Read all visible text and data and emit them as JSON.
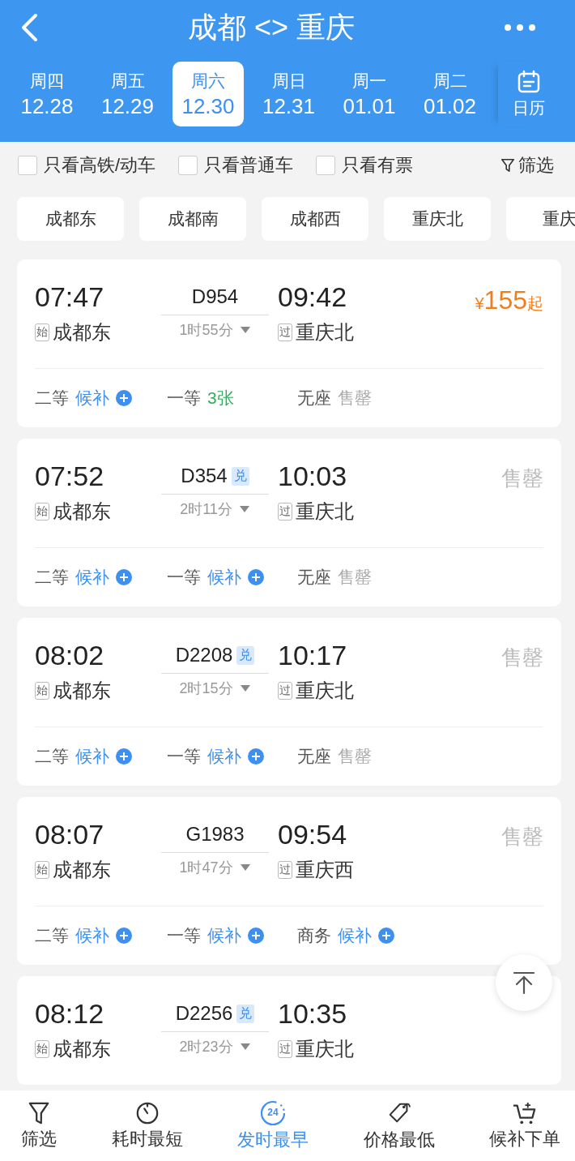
{
  "header": {
    "title": "成都 <> 重庆"
  },
  "dates": [
    {
      "weekday": "周四",
      "date": "12.28",
      "selected": false
    },
    {
      "weekday": "周五",
      "date": "12.29",
      "selected": false
    },
    {
      "weekday": "周六",
      "date": "12.30",
      "selected": true
    },
    {
      "weekday": "周日",
      "date": "12.31",
      "selected": false
    },
    {
      "weekday": "周一",
      "date": "01.01",
      "selected": false
    },
    {
      "weekday": "周二",
      "date": "01.02",
      "selected": false
    }
  ],
  "calendar_label": "日历",
  "filters": [
    {
      "label": "只看高铁/动车",
      "checked": false
    },
    {
      "label": "只看普通车",
      "checked": false
    },
    {
      "label": "只看有票",
      "checked": false
    }
  ],
  "filter_button": "筛选",
  "stations": [
    "成都东",
    "成都南",
    "成都西",
    "重庆北",
    "重庆"
  ],
  "trains": [
    {
      "depart": "07:47",
      "number": "D954",
      "arrive": "09:42",
      "from_tag": "始",
      "from": "成都东",
      "duration": "1时55分",
      "to_tag": "过",
      "to": "重庆北",
      "fare": {
        "kind": "price",
        "currency": "¥",
        "amount": "155",
        "suffix": "起"
      },
      "seats": [
        {
          "class": "二等",
          "status": "候补",
          "kind": "waitlist"
        },
        {
          "class": "一等",
          "status": "3张",
          "kind": "count"
        },
        {
          "class": "无座",
          "status": "售罄",
          "kind": "soldout"
        }
      ]
    },
    {
      "depart": "07:52",
      "number": "D354",
      "badge": "兑",
      "arrive": "10:03",
      "from_tag": "始",
      "from": "成都东",
      "duration": "2时11分",
      "to_tag": "过",
      "to": "重庆北",
      "fare": {
        "kind": "soldout",
        "text": "售罄"
      },
      "seats": [
        {
          "class": "二等",
          "status": "候补",
          "kind": "waitlist"
        },
        {
          "class": "一等",
          "status": "候补",
          "kind": "waitlist"
        },
        {
          "class": "无座",
          "status": "售罄",
          "kind": "soldout"
        }
      ]
    },
    {
      "depart": "08:02",
      "number": "D2208",
      "badge": "兑",
      "arrive": "10:17",
      "from_tag": "始",
      "from": "成都东",
      "duration": "2时15分",
      "to_tag": "过",
      "to": "重庆北",
      "fare": {
        "kind": "soldout",
        "text": "售罄"
      },
      "seats": [
        {
          "class": "二等",
          "status": "候补",
          "kind": "waitlist"
        },
        {
          "class": "一等",
          "status": "候补",
          "kind": "waitlist"
        },
        {
          "class": "无座",
          "status": "售罄",
          "kind": "soldout"
        }
      ]
    },
    {
      "depart": "08:07",
      "number": "G1983",
      "arrive": "09:54",
      "from_tag": "始",
      "from": "成都东",
      "duration": "1时47分",
      "to_tag": "过",
      "to": "重庆西",
      "fare": {
        "kind": "soldout",
        "text": "售罄"
      },
      "seats": [
        {
          "class": "二等",
          "status": "候补",
          "kind": "waitlist"
        },
        {
          "class": "一等",
          "status": "候补",
          "kind": "waitlist"
        },
        {
          "class": "商务",
          "status": "候补",
          "kind": "waitlist"
        }
      ]
    },
    {
      "depart": "08:12",
      "number": "D2256",
      "badge": "兑",
      "arrive": "10:35",
      "from_tag": "始",
      "from": "成都东",
      "duration": "2时23分",
      "to_tag": "过",
      "to": "重庆北"
    }
  ],
  "bottom_tabs": [
    {
      "label": "筛选",
      "kind": "filter",
      "selected": false
    },
    {
      "label": "耗时最短",
      "kind": "timer",
      "selected": false
    },
    {
      "label": "发时最早",
      "kind": "clock",
      "icon_text": "24",
      "selected": true
    },
    {
      "label": "价格最低",
      "kind": "tag",
      "selected": false
    },
    {
      "label": "候补下单",
      "kind": "cart",
      "selected": false
    }
  ]
}
